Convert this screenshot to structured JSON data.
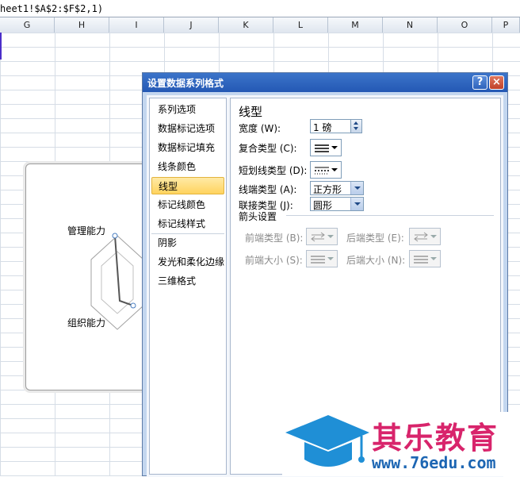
{
  "formula_bar": {
    "text": "heet1!$A$2:$F$2,1)"
  },
  "columns": [
    "G",
    "H",
    "I",
    "J",
    "K",
    "L",
    "M",
    "N",
    "O",
    "P"
  ],
  "chart": {
    "labels": [
      "管理能力",
      "组织能力"
    ]
  },
  "dialog": {
    "title": "设置数据系列格式",
    "help_glyph": "?",
    "close_glyph": "×",
    "nav_items": [
      "系列选项",
      "数据标记选项",
      "数据标记填充",
      "线条颜色",
      "线型",
      "标记线颜色",
      "标记线样式",
      "阴影",
      "发光和柔化边缘",
      "三维格式"
    ],
    "selected_index": 4,
    "panel": {
      "title": "线型",
      "width_label": "宽度 (W):",
      "width_value": "1 磅",
      "compound_label": "复合类型 (C):",
      "dash_label": "短划线类型 (D):",
      "cap_label": "线端类型 (A):",
      "cap_value": "正方形",
      "join_label": "联接类型 (J):",
      "join_value": "圆形",
      "arrow_section": "箭头设置",
      "begin_type_label": "前端类型 (B):",
      "end_type_label": "后端类型 (E):",
      "begin_size_label": "前端大小 (S):",
      "end_size_label": "后端大小 (N):"
    }
  },
  "watermark": {
    "brand": "其乐教育",
    "url": "www.76edu.com",
    "icon": "graduation-cap-icon",
    "cap_color": "#1f8fd6"
  }
}
